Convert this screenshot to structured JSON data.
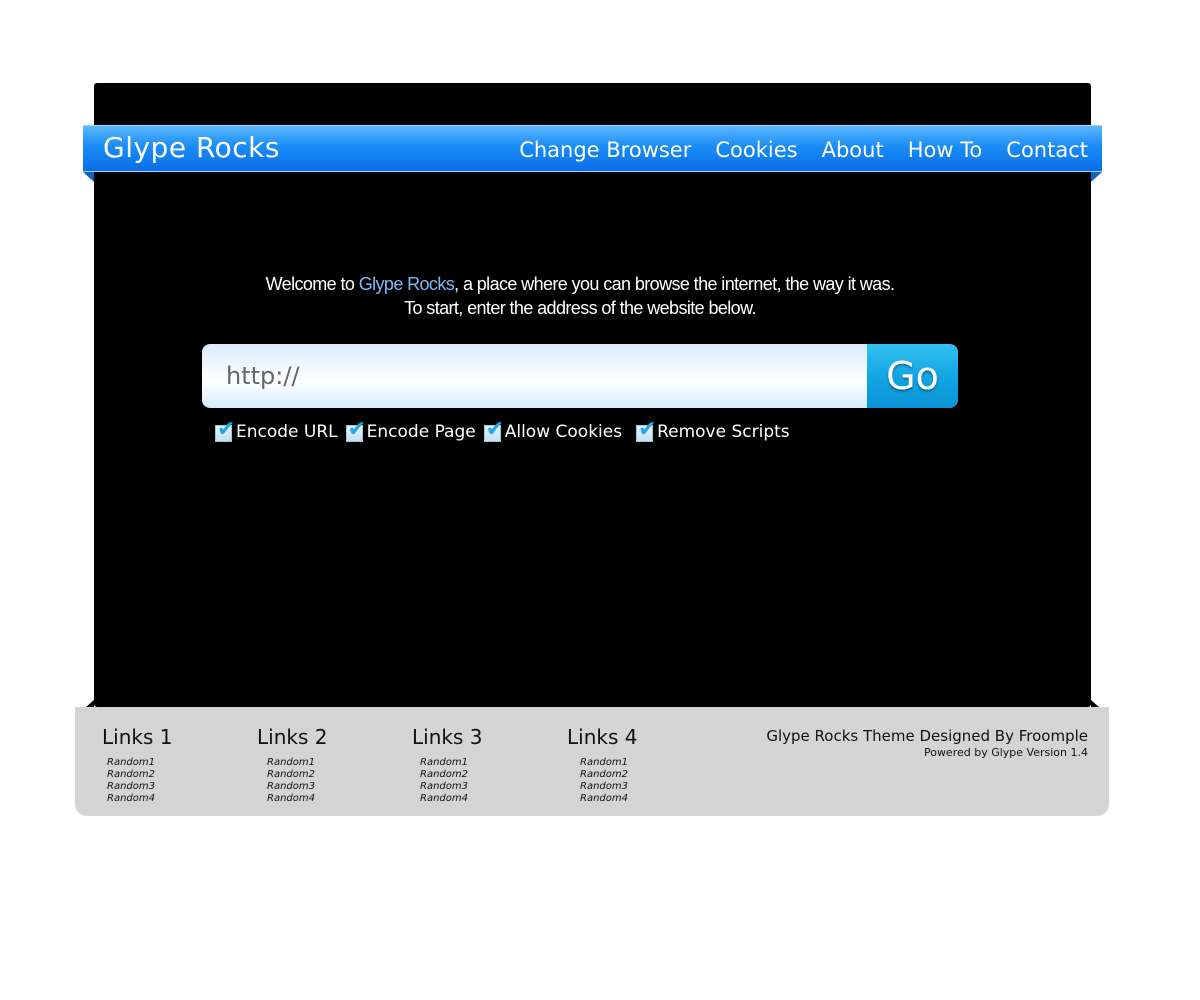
{
  "header": {
    "title": "Glype Rocks",
    "nav": [
      "Change Browser",
      "Cookies",
      "About",
      "How To",
      "Contact"
    ]
  },
  "welcome": {
    "prefix": "Welcome to ",
    "brand": "Glype Rocks",
    "line1_rest": ", a place where you can browse the internet, the way it was.",
    "line2": "To start, enter the address of the website below."
  },
  "form": {
    "url_value": "http://",
    "go_label": "Go",
    "options": [
      {
        "label": "Encode URL",
        "checked": true
      },
      {
        "label": "Encode Page",
        "checked": true
      },
      {
        "label": "Allow Cookies",
        "checked": true
      },
      {
        "label": "Remove Scripts",
        "checked": true
      }
    ]
  },
  "footer": {
    "columns": [
      {
        "heading": "Links 1",
        "items": [
          "Random1",
          "Random2",
          "Random3",
          "Random4"
        ]
      },
      {
        "heading": "Links 2",
        "items": [
          "Random1",
          "Random2",
          "Random3",
          "Random4"
        ]
      },
      {
        "heading": "Links 3",
        "items": [
          "Random1",
          "Random2",
          "Random3",
          "Random4"
        ]
      },
      {
        "heading": "Links 4",
        "items": [
          "Random1",
          "Random2",
          "Random3",
          "Random4"
        ]
      }
    ],
    "credit": "Glype Rocks Theme Designed By Froomple",
    "powered": "Powered by Glype Version 1.4"
  },
  "colors": {
    "nav_blue": "#1a8cf5",
    "brand_text": "#7fb8f5",
    "go_button": "#12a6e3",
    "footer_bg": "#d4d4d4"
  }
}
